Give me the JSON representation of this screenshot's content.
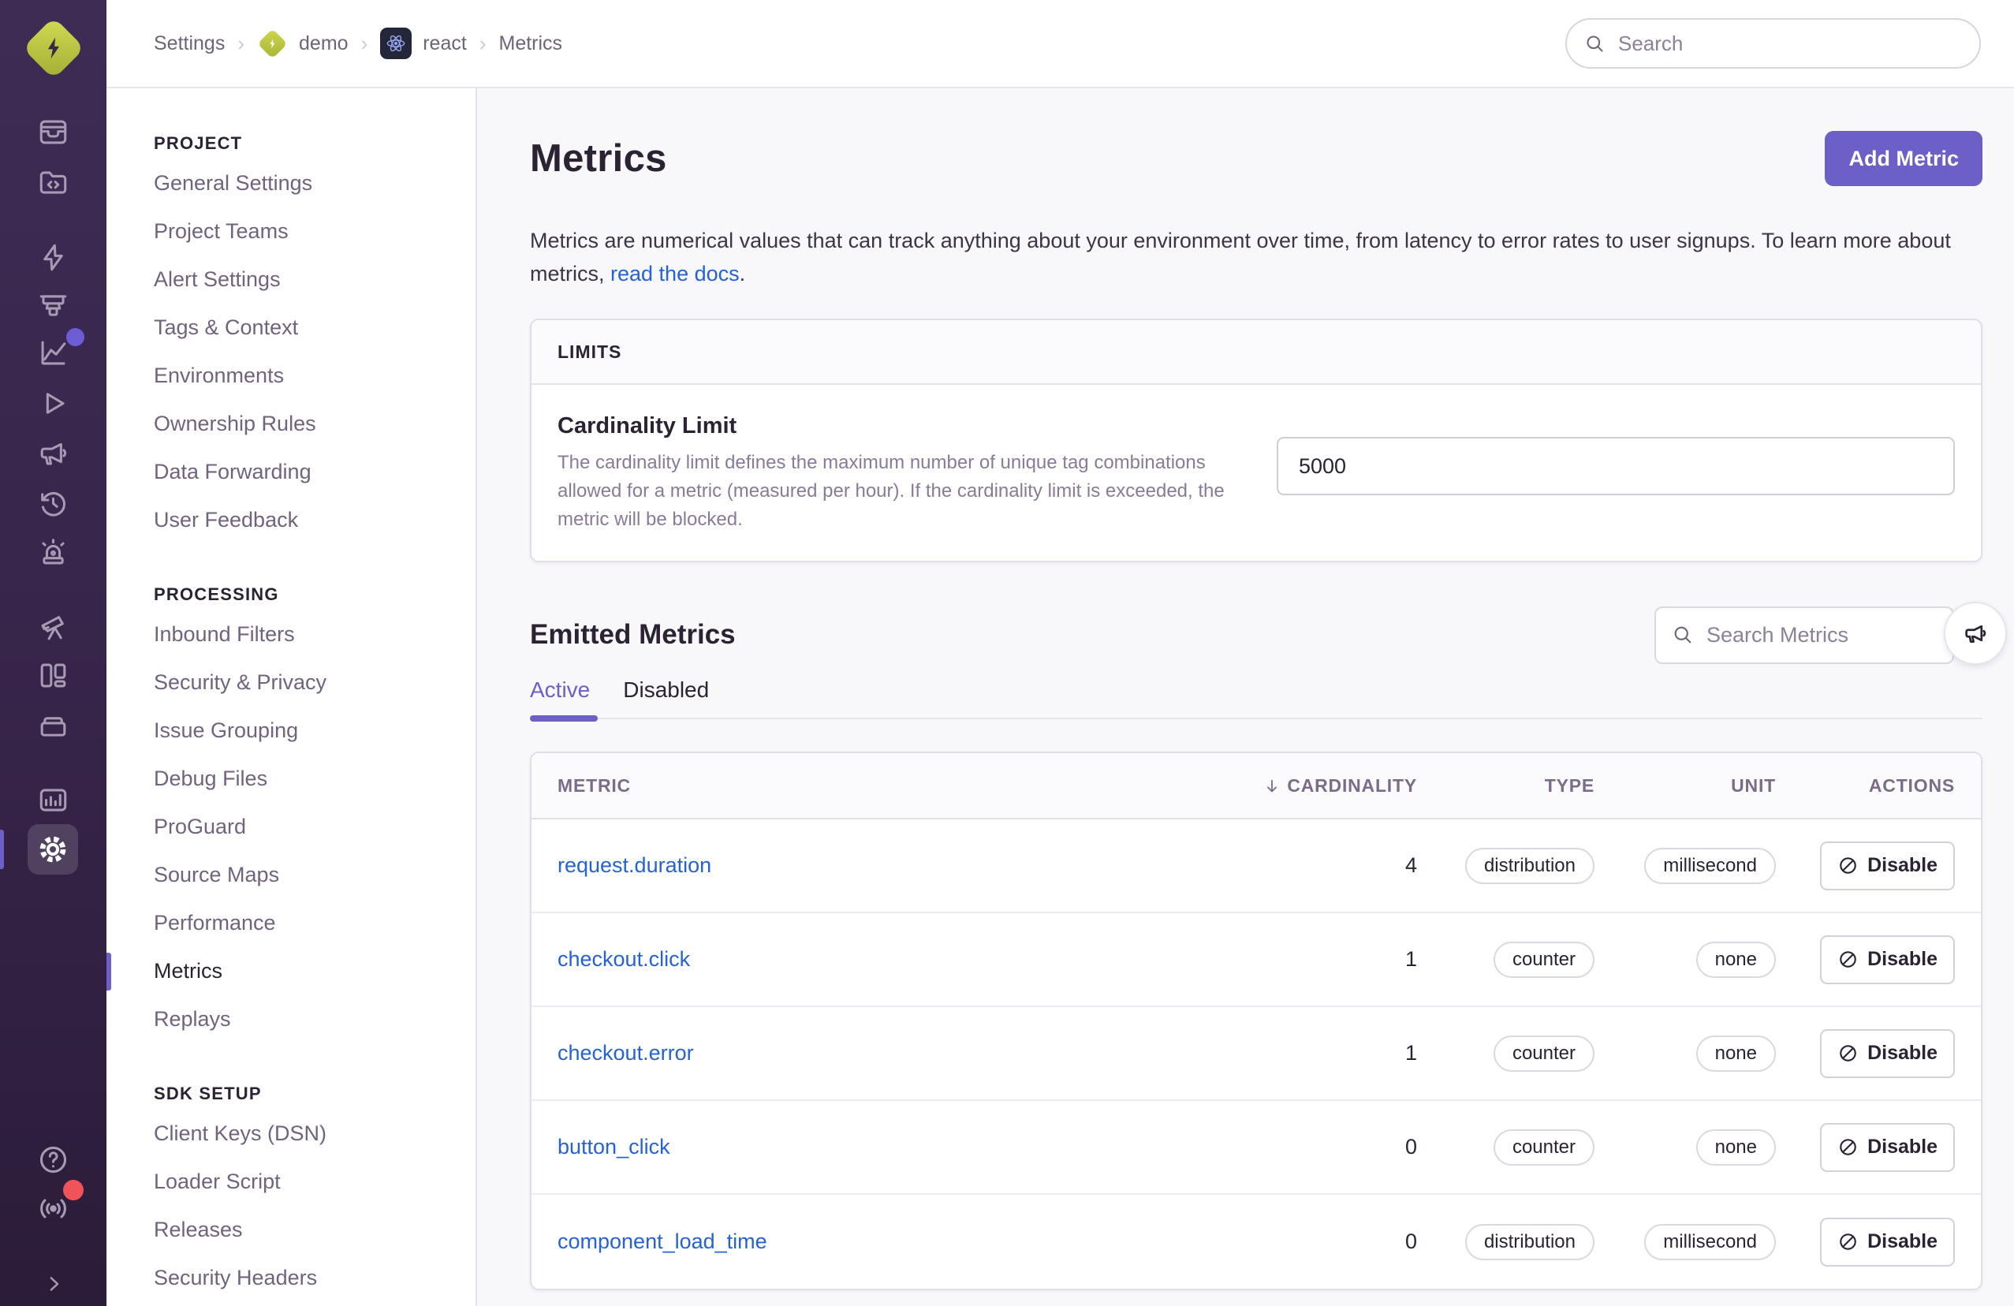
{
  "colors": {
    "accent_purple": "#6C5FC7",
    "link_blue": "#2562D4",
    "sidebar_dark": "#372449",
    "notification_red": "#F0545A",
    "org_lime": "#BDC93F",
    "content_bg": "#F8F7FA"
  },
  "breadcrumb": {
    "settings": "Settings",
    "org": "demo",
    "project": "react",
    "page": "Metrics"
  },
  "topbar": {
    "search_placeholder": "Search"
  },
  "sidebar": {
    "icons": [
      "issues",
      "explore",
      "bolt",
      "projector",
      "performance-chart",
      "replays-play",
      "feedback-megaphone",
      "history-clock",
      "alerts-siren",
      "discover-telescope",
      "dashboards-layout",
      "archive-drawer",
      "stats-bars",
      "settings-gear",
      "help",
      "whats-new-broadcast",
      "expand-chevron"
    ]
  },
  "nav": {
    "sections": [
      {
        "title": "PROJECT",
        "items": [
          "General Settings",
          "Project Teams",
          "Alert Settings",
          "Tags & Context",
          "Environments",
          "Ownership Rules",
          "Data Forwarding",
          "User Feedback"
        ]
      },
      {
        "title": "PROCESSING",
        "items": [
          "Inbound Filters",
          "Security & Privacy",
          "Issue Grouping",
          "Debug Files",
          "ProGuard",
          "Source Maps",
          "Performance",
          "Metrics",
          "Replays"
        ]
      },
      {
        "title": "SDK SETUP",
        "items": [
          "Client Keys (DSN)",
          "Loader Script",
          "Releases",
          "Security Headers"
        ]
      }
    ],
    "active_item": "Metrics"
  },
  "main": {
    "title": "Metrics",
    "add_button": "Add Metric",
    "description_before": "Metrics are numerical values that can track anything about your environment over time, from latency to error rates to user signups. To learn more about metrics, ",
    "docs_link": "read the docs",
    "description_after": ".",
    "limits": {
      "header": "LIMITS",
      "field_label": "Cardinality Limit",
      "field_help": "The cardinality limit defines the maximum number of unique tag combinations allowed for a metric (measured per hour). If the cardinality limit is exceeded, the metric will be blocked.",
      "value": "5000"
    },
    "emitted": {
      "title": "Emitted Metrics",
      "search_placeholder": "Search Metrics",
      "tabs": {
        "active": "Active",
        "disabled": "Disabled"
      }
    },
    "table": {
      "columns": [
        "METRIC",
        "CARDINALITY",
        "TYPE",
        "UNIT",
        "ACTIONS"
      ],
      "sorted_by": "CARDINALITY",
      "rows": [
        {
          "metric": "request.duration",
          "cardinality": "4",
          "type": "distribution",
          "unit": "millisecond",
          "action": "Disable"
        },
        {
          "metric": "checkout.click",
          "cardinality": "1",
          "type": "counter",
          "unit": "none",
          "action": "Disable"
        },
        {
          "metric": "checkout.error",
          "cardinality": "1",
          "type": "counter",
          "unit": "none",
          "action": "Disable"
        },
        {
          "metric": "button_click",
          "cardinality": "0",
          "type": "counter",
          "unit": "none",
          "action": "Disable"
        },
        {
          "metric": "component_load_time",
          "cardinality": "0",
          "type": "distribution",
          "unit": "millisecond",
          "action": "Disable"
        }
      ]
    }
  }
}
